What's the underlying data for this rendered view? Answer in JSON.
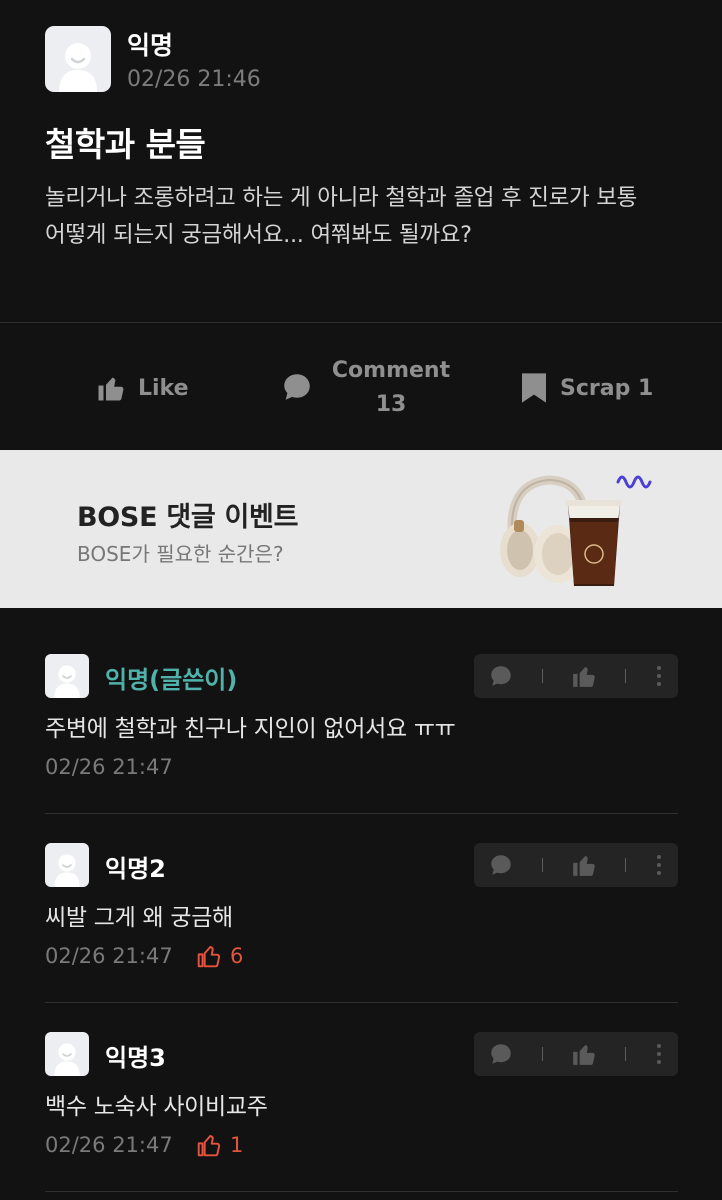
{
  "post": {
    "author": "익명",
    "time": "02/26 21:46",
    "title": "철학과 분들",
    "body": "놀리거나 조롱하려고 하는 게 아니라 철학과 졸업 후 진로가 보통 어떻게 되는지 궁금해서요... 여쭤봐도 될까요?",
    "actions": {
      "like_label": "Like",
      "comment_label": "Comment",
      "comment_count": "13",
      "scrap_label": "Scrap 1"
    }
  },
  "banner": {
    "title": "BOSE 댓글 이벤트",
    "subtitle": "BOSE가 필요한 순간은?"
  },
  "comments": [
    {
      "author": "익명(글쓴이)",
      "text": "주변에 철학과 친구나 지인이 없어서요 ㅠㅠ",
      "time": "02/26 21:47",
      "likes": null
    },
    {
      "author": "익명2",
      "text": "씨발 그게 왜 궁금해",
      "time": "02/26 21:47",
      "likes": "6"
    },
    {
      "author": "익명3",
      "text": "백수 노숙사 사이비교주",
      "time": "02/26 21:47",
      "likes": "1"
    }
  ],
  "colors": {
    "background": "#121212",
    "op_name": "#4fb3ab",
    "like_accent": "#e2543f",
    "banner_bg": "#e9e9e9"
  },
  "icons": [
    "avatar-icon",
    "thumbs-up-icon",
    "comment-bubble-icon",
    "bookmark-icon",
    "more-vertical-icon"
  ]
}
